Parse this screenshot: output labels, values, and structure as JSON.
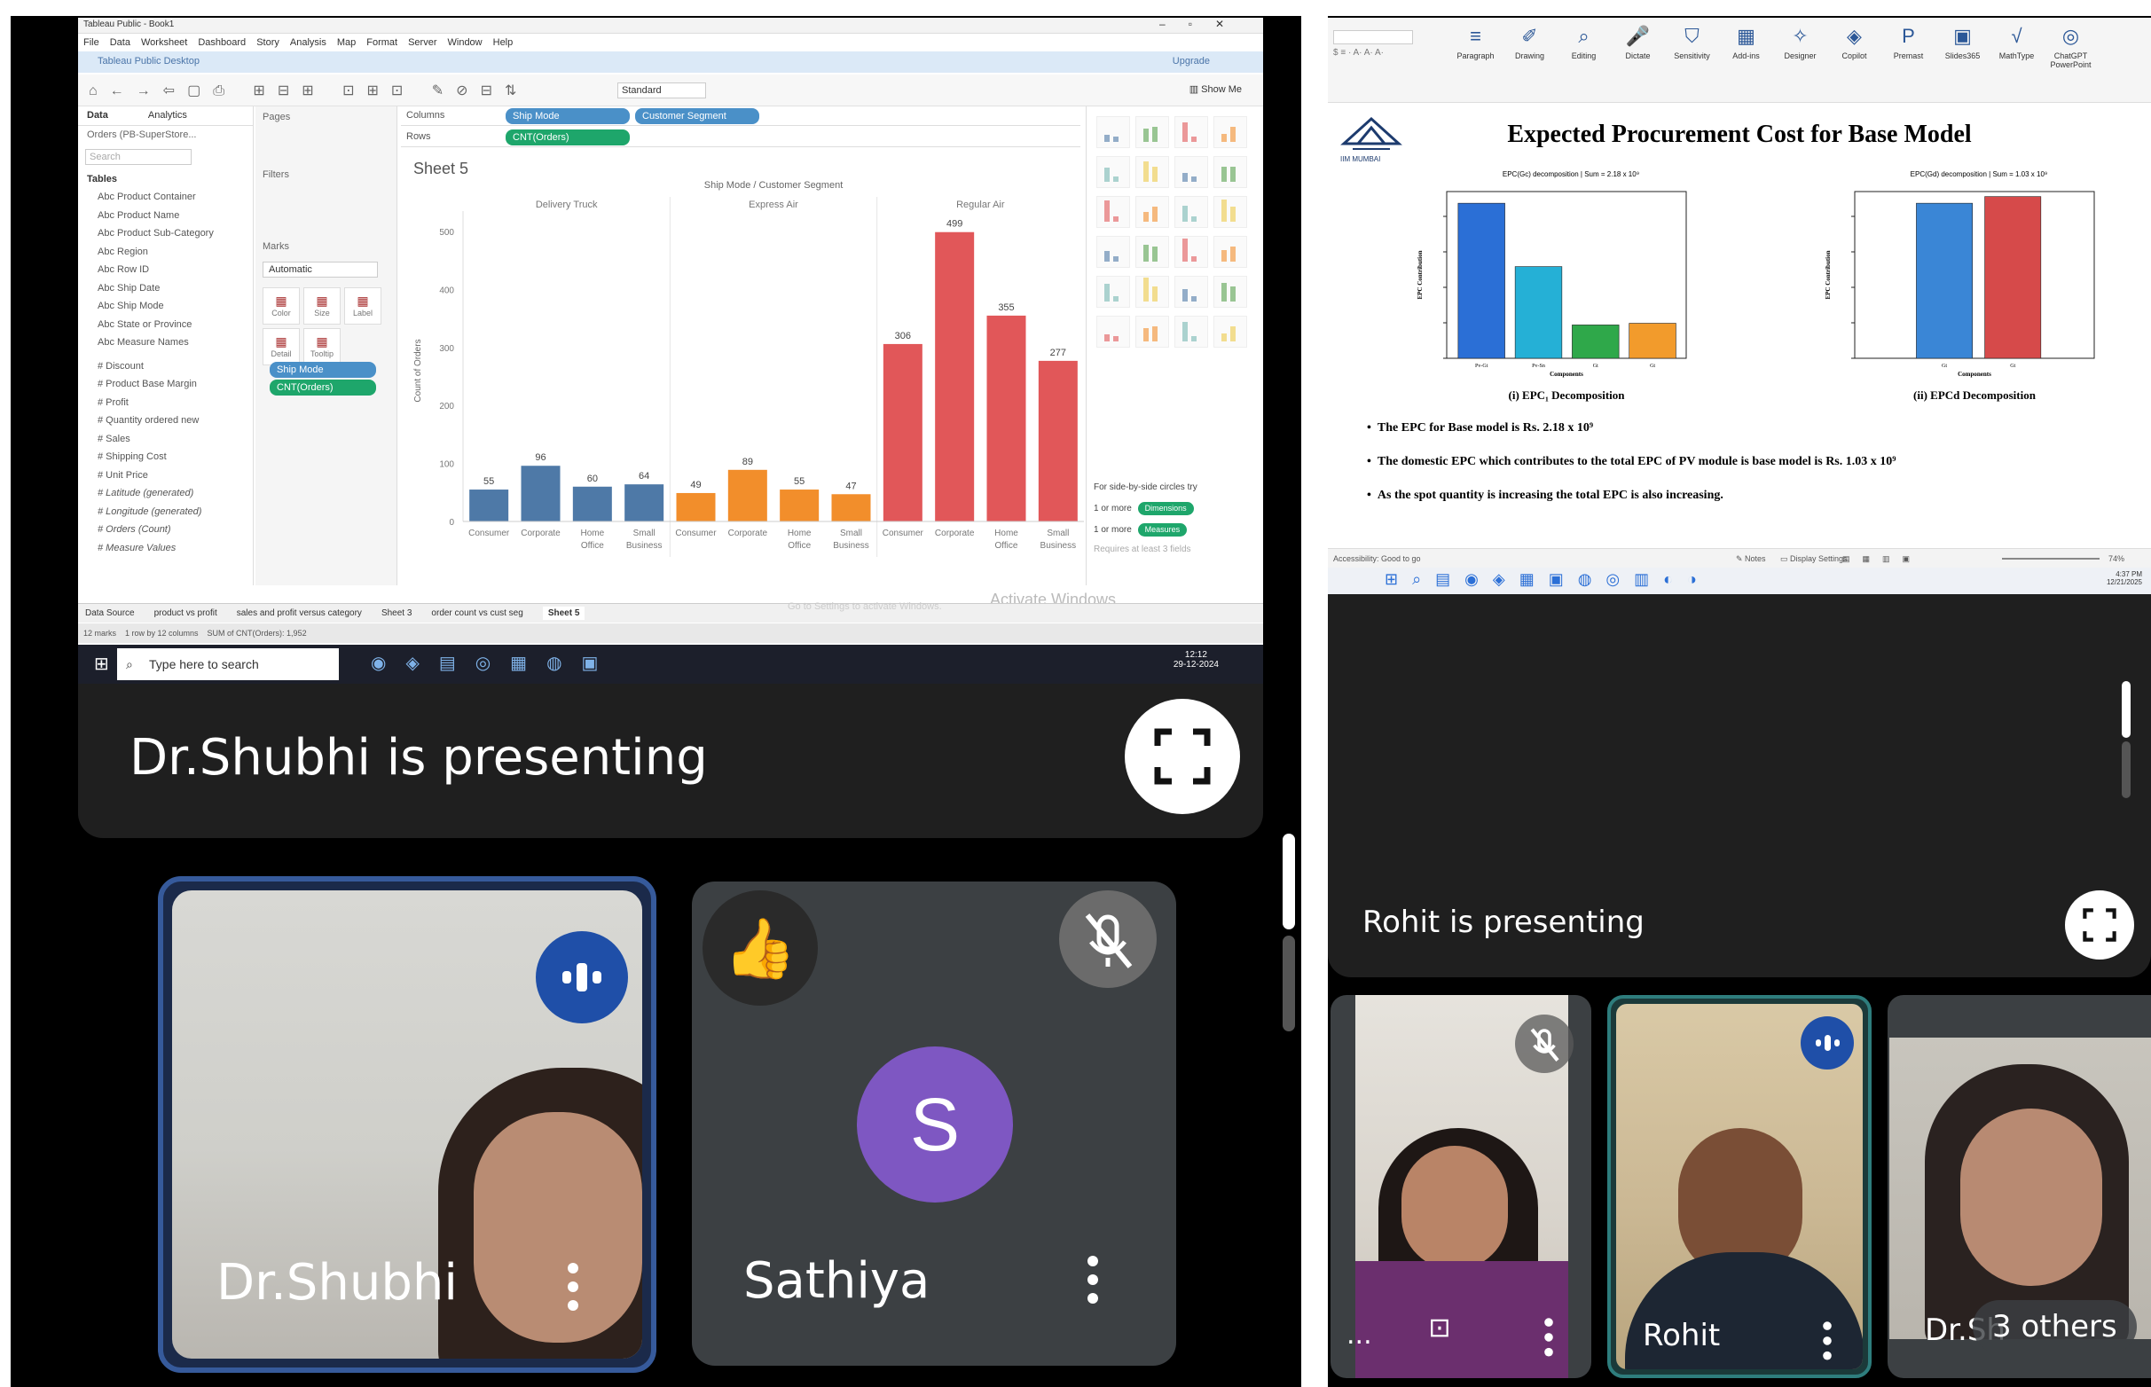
{
  "colors": {
    "meet_bg": "#000000",
    "tile_bg": "#3c4043",
    "active_border": "#8ab4f8",
    "speak_blue": "#1a56d6",
    "bar_blue": "#4e79a7",
    "bar_orange": "#f28e2b",
    "bar_red": "#e15759",
    "avatar_purple": "#7e57c2"
  },
  "left_presentation": {
    "presenter_text": "Dr.Shubhi is presenting"
  },
  "tableau": {
    "window_title": "Tableau Public - Book1",
    "menu": [
      "File",
      "Data",
      "Worksheet",
      "Dashboard",
      "Story",
      "Analysis",
      "Map",
      "Format",
      "Server",
      "Window",
      "Help"
    ],
    "app_bar_title": "Tableau Public Desktop",
    "upgrade_label": "Upgrade",
    "toolbar_fit": "Standard",
    "show_me_label": "Show Me",
    "tabs": [
      "Data",
      "Analytics"
    ],
    "datasource": "Orders (PB-SuperStore...",
    "search_placeholder": "Search",
    "tables_header": "Tables",
    "fields": [
      "Product Container",
      "Product Name",
      "Product Sub-Category",
      "Region",
      "Row ID",
      "Ship Date",
      "Ship Mode",
      "State or Province",
      "Measure Names",
      "Discount",
      "Product Base Margin",
      "Profit",
      "Quantity ordered new",
      "Sales",
      "Shipping Cost",
      "Unit Price",
      "Latitude (generated)",
      "Longitude (generated)",
      "Orders (Count)",
      "Measure Values"
    ],
    "pages_label": "Pages",
    "filters_label": "Filters",
    "marks_label": "Marks",
    "marks_type": "Automatic",
    "marks_buttons": [
      "Color",
      "Size",
      "Label",
      "Detail",
      "Tooltip"
    ],
    "marks_pills": [
      "Ship Mode",
      "CNT(Orders)"
    ],
    "columns_label": "Columns",
    "rows_label": "Rows",
    "columns_pills": [
      "Ship Mode",
      "Customer Segment"
    ],
    "rows_pills": [
      "CNT(Orders)"
    ],
    "sheet_title": "Sheet 5",
    "chart_header": "Ship Mode / Customer Segment",
    "showme_hint": "For side-by-side circles try",
    "showme_dim": "1 or more",
    "showme_dim_pill": "Dimensions",
    "showme_meas": "1 or more",
    "showme_meas_pill": "Measures",
    "showme_req": "Requires at least 3 fields",
    "activate_title": "Activate Windows",
    "activate_sub": "Go to Settings to activate Windows.",
    "sheet_tabs": [
      "Data Source",
      "product vs profit",
      "sales and profit versus category",
      "Sheet 3",
      "order count vs cust seg",
      "Sheet 5"
    ],
    "status_bar": "12 marks    1 row by 12 columns    SUM of CNT(Orders): 1,952",
    "taskbar_search": "Type here to search",
    "taskbar_time": "12:12",
    "taskbar_date": "29-12-2024"
  },
  "chart_data": {
    "type": "bar",
    "title": "Ship Mode / Customer Segment",
    "groups": [
      "Delivery Truck",
      "Express Air",
      "Regular Air"
    ],
    "categories": [
      "Consumer",
      "Corporate",
      "Home Office",
      "Small Business"
    ],
    "category_labels": [
      "Consumer",
      "Corporate",
      "Home\nOffice",
      "Small\nBusiness"
    ],
    "series": [
      {
        "name": "Delivery Truck",
        "values": [
          55,
          96,
          60,
          64
        ],
        "color": "#4e79a7"
      },
      {
        "name": "Express Air",
        "values": [
          49,
          89,
          55,
          47
        ],
        "color": "#f28e2b"
      },
      {
        "name": "Regular Air",
        "values": [
          306,
          499,
          355,
          277
        ],
        "color": "#e15759"
      }
    ],
    "ylabel": "Count of Orders",
    "yticks": [
      0,
      100,
      200,
      300,
      400,
      500
    ],
    "ylim": [
      0,
      520
    ],
    "grid": false
  },
  "ppt": {
    "ribbon_items": [
      "Paragraph",
      "Drawing",
      "Editing",
      "Dictate",
      "Sensitivity",
      "Add-ins",
      "Designer",
      "Copilot",
      "Premast",
      "Slides365",
      "MathType",
      "ChatGPT PowerPoint"
    ],
    "logo_text": "IIM MUMBAI",
    "slide_title": "Expected Procurement Cost for Base Model",
    "left_chart_header": "EPC(Gc) decomposition | Sum = 2.18 x 10⁹",
    "left_chart_caption": "(i) EPC₁ Decomposition",
    "left_chart_xlabel": "Components",
    "left_chart_ylabel": "EPC Contribution",
    "right_chart_header": "EPC(Gd) decomposition | Sum = 1.03 x 10⁹",
    "right_chart_caption": "(ii) EPCd Decomposition",
    "right_chart_xlabel": "Components",
    "right_chart_ylabel": "EPC Contribution",
    "bullets": [
      "The EPC for Base model is Rs. 2.18 x 10⁹",
      "The domestic EPC which contributes to the total EPC of PV module is base model is Rs. 1.03 x 10⁹",
      "As the spot quantity is increasing the total EPC is also increasing."
    ],
    "status_left": "Accessibility: Good to go",
    "status_notes": "Notes",
    "status_display": "Display Settings",
    "zoom": "74%",
    "taskbar_time": "4:37 PM",
    "taskbar_date": "12/21/2025"
  },
  "chart_data_ppt": {
    "left": {
      "bar_fill_fractions": [
        0.93,
        0.55,
        0.2,
        0.21
      ],
      "colors": [
        "#2b6fd6",
        "#25b0d6",
        "#2fa84a",
        "#f29b2c"
      ],
      "tick_labels": [
        "Pv-Gt",
        "Pv-Sn",
        "Gt",
        "Gt"
      ]
    },
    "right": {
      "bar_fill_fractions": [
        0.93,
        0.97
      ],
      "colors": [
        "#3a86d6",
        "#d64a4a"
      ],
      "tick_labels": [
        "Gt",
        "Gt"
      ]
    }
  },
  "right_presentation": {
    "presenter_text": "Rohit is presenting"
  },
  "participants": {
    "drshubhi": {
      "name": "Dr.Shubhi"
    },
    "sathiya": {
      "name": "Sathiya",
      "initial": "S",
      "reaction": "👍"
    },
    "woman": {
      "name": "..."
    },
    "rohit": {
      "name": "Rohit"
    },
    "others": {
      "name": "Dr.Sh",
      "others_label": "3 others"
    }
  },
  "icons": {
    "fullscreen": "fullscreen-icon",
    "more": "more-vert-icon",
    "mic_off": "mic-off-icon",
    "speaking": "audio-level-icon",
    "pin": "pin-icon"
  }
}
